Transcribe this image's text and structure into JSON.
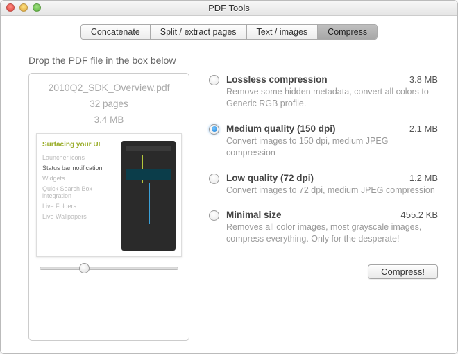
{
  "window": {
    "title": "PDF Tools"
  },
  "tabs": [
    {
      "label": "Concatenate"
    },
    {
      "label": "Split / extract pages"
    },
    {
      "label": "Text / images"
    },
    {
      "label": "Compress"
    }
  ],
  "instruction": "Drop the PDF file in the box below",
  "file": {
    "name": "2010Q2_SDK_Overview.pdf",
    "pages": "32 pages",
    "size": "3.4 MB"
  },
  "preview": {
    "title": "Surfacing your UI",
    "items": [
      {
        "label": "Launcher icons",
        "active": false
      },
      {
        "label": "Status bar notification",
        "active": true
      },
      {
        "label": "Widgets",
        "active": false
      },
      {
        "label": "Quick Search Box integration",
        "active": false
      },
      {
        "label": "Live Folders",
        "active": false
      },
      {
        "label": "Live Wallpapers",
        "active": false
      }
    ]
  },
  "options": [
    {
      "title": "Lossless compression",
      "size": "3.8 MB",
      "desc": "Remove some hidden metadata, convert all colors to Generic RGB profile.",
      "selected": false
    },
    {
      "title": "Medium quality (150 dpi)",
      "size": "2.1 MB",
      "desc": "Convert images to 150 dpi, medium JPEG compression",
      "selected": true
    },
    {
      "title": "Low quality (72 dpi)",
      "size": "1.2 MB",
      "desc": "Convert images to 72 dpi, medium JPEG compression",
      "selected": false
    },
    {
      "title": "Minimal size",
      "size": "455.2 KB",
      "desc": "Removes all color images, most grayscale images, compress everything. Only for the desperate!",
      "selected": false
    }
  ],
  "action_button": "Compress!"
}
